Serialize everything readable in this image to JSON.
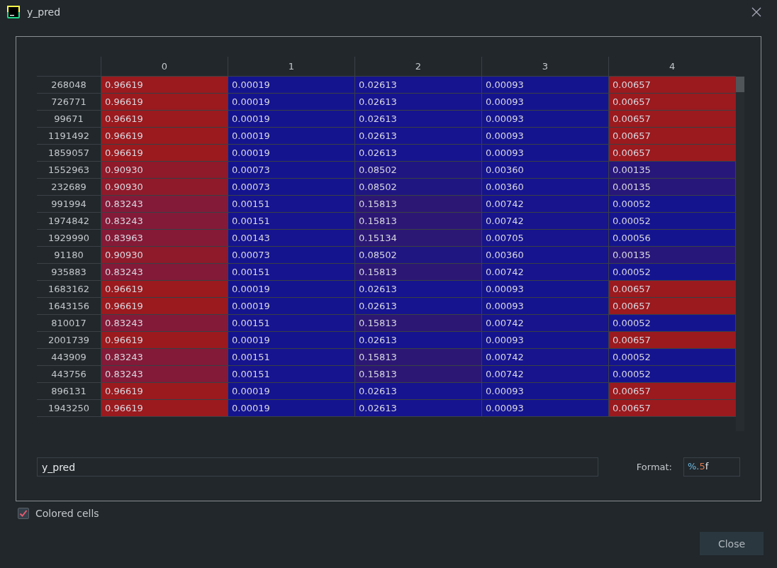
{
  "window": {
    "title": "y_pred"
  },
  "table": {
    "columns": [
      "0",
      "1",
      "2",
      "3",
      "4"
    ],
    "rows": [
      {
        "index": "268048",
        "cells": [
          {
            "value": "0.96619",
            "color": "#9a1a1e"
          },
          {
            "value": "0.00019",
            "color": "#15148f"
          },
          {
            "value": "0.02613",
            "color": "#16148e"
          },
          {
            "value": "0.00093",
            "color": "#15148f"
          },
          {
            "value": "0.00657",
            "color": "#9a1a1e"
          }
        ]
      },
      {
        "index": "726771",
        "cells": [
          {
            "value": "0.96619",
            "color": "#9a1a1e"
          },
          {
            "value": "0.00019",
            "color": "#15148f"
          },
          {
            "value": "0.02613",
            "color": "#16148e"
          },
          {
            "value": "0.00093",
            "color": "#15148f"
          },
          {
            "value": "0.00657",
            "color": "#9a1a1e"
          }
        ]
      },
      {
        "index": "99671",
        "cells": [
          {
            "value": "0.96619",
            "color": "#9a1a1e"
          },
          {
            "value": "0.00019",
            "color": "#15148f"
          },
          {
            "value": "0.02613",
            "color": "#16148e"
          },
          {
            "value": "0.00093",
            "color": "#15148f"
          },
          {
            "value": "0.00657",
            "color": "#9a1a1e"
          }
        ]
      },
      {
        "index": "1191492",
        "cells": [
          {
            "value": "0.96619",
            "color": "#9a1a1e"
          },
          {
            "value": "0.00019",
            "color": "#15148f"
          },
          {
            "value": "0.02613",
            "color": "#16148e"
          },
          {
            "value": "0.00093",
            "color": "#15148f"
          },
          {
            "value": "0.00657",
            "color": "#9a1a1e"
          }
        ]
      },
      {
        "index": "1859057",
        "cells": [
          {
            "value": "0.96619",
            "color": "#9a1a1e"
          },
          {
            "value": "0.00019",
            "color": "#15148f"
          },
          {
            "value": "0.02613",
            "color": "#16148e"
          },
          {
            "value": "0.00093",
            "color": "#15148f"
          },
          {
            "value": "0.00657",
            "color": "#9a1a1e"
          }
        ]
      },
      {
        "index": "1552963",
        "cells": [
          {
            "value": "0.90930",
            "color": "#8e1a2a"
          },
          {
            "value": "0.00073",
            "color": "#15148f"
          },
          {
            "value": "0.08502",
            "color": "#201682"
          },
          {
            "value": "0.00360",
            "color": "#16148e"
          },
          {
            "value": "0.00135",
            "color": "#28177a"
          }
        ]
      },
      {
        "index": "232689",
        "cells": [
          {
            "value": "0.90930",
            "color": "#8e1a2a"
          },
          {
            "value": "0.00073",
            "color": "#15148f"
          },
          {
            "value": "0.08502",
            "color": "#201682"
          },
          {
            "value": "0.00360",
            "color": "#16148e"
          },
          {
            "value": "0.00135",
            "color": "#28177a"
          }
        ]
      },
      {
        "index": "991994",
        "cells": [
          {
            "value": "0.83243",
            "color": "#821a38"
          },
          {
            "value": "0.00151",
            "color": "#16148e"
          },
          {
            "value": "0.15813",
            "color": "#2c1874"
          },
          {
            "value": "0.00742",
            "color": "#17148d"
          },
          {
            "value": "0.00052",
            "color": "#15148f"
          }
        ]
      },
      {
        "index": "1974842",
        "cells": [
          {
            "value": "0.83243",
            "color": "#821a38"
          },
          {
            "value": "0.00151",
            "color": "#16148e"
          },
          {
            "value": "0.15813",
            "color": "#2c1874"
          },
          {
            "value": "0.00742",
            "color": "#17148d"
          },
          {
            "value": "0.00052",
            "color": "#15148f"
          }
        ]
      },
      {
        "index": "1929990",
        "cells": [
          {
            "value": "0.83963",
            "color": "#841a36"
          },
          {
            "value": "0.00143",
            "color": "#16148e"
          },
          {
            "value": "0.15134",
            "color": "#2b1875"
          },
          {
            "value": "0.00705",
            "color": "#17148d"
          },
          {
            "value": "0.00056",
            "color": "#15148f"
          }
        ]
      },
      {
        "index": "91180",
        "cells": [
          {
            "value": "0.90930",
            "color": "#8e1a2a"
          },
          {
            "value": "0.00073",
            "color": "#15148f"
          },
          {
            "value": "0.08502",
            "color": "#201682"
          },
          {
            "value": "0.00360",
            "color": "#16148e"
          },
          {
            "value": "0.00135",
            "color": "#28177a"
          }
        ]
      },
      {
        "index": "935883",
        "cells": [
          {
            "value": "0.83243",
            "color": "#821a38"
          },
          {
            "value": "0.00151",
            "color": "#16148e"
          },
          {
            "value": "0.15813",
            "color": "#2c1874"
          },
          {
            "value": "0.00742",
            "color": "#17148d"
          },
          {
            "value": "0.00052",
            "color": "#15148f"
          }
        ]
      },
      {
        "index": "1683162",
        "cells": [
          {
            "value": "0.96619",
            "color": "#9a1a1e"
          },
          {
            "value": "0.00019",
            "color": "#15148f"
          },
          {
            "value": "0.02613",
            "color": "#16148e"
          },
          {
            "value": "0.00093",
            "color": "#15148f"
          },
          {
            "value": "0.00657",
            "color": "#9a1a1e"
          }
        ]
      },
      {
        "index": "1643156",
        "cells": [
          {
            "value": "0.96619",
            "color": "#9a1a1e"
          },
          {
            "value": "0.00019",
            "color": "#15148f"
          },
          {
            "value": "0.02613",
            "color": "#16148e"
          },
          {
            "value": "0.00093",
            "color": "#15148f"
          },
          {
            "value": "0.00657",
            "color": "#9a1a1e"
          }
        ]
      },
      {
        "index": "810017",
        "cells": [
          {
            "value": "0.83243",
            "color": "#821a38"
          },
          {
            "value": "0.00151",
            "color": "#16148e"
          },
          {
            "value": "0.15813",
            "color": "#2c1874"
          },
          {
            "value": "0.00742",
            "color": "#17148d"
          },
          {
            "value": "0.00052",
            "color": "#15148f"
          }
        ]
      },
      {
        "index": "2001739",
        "cells": [
          {
            "value": "0.96619",
            "color": "#9a1a1e"
          },
          {
            "value": "0.00019",
            "color": "#15148f"
          },
          {
            "value": "0.02613",
            "color": "#16148e"
          },
          {
            "value": "0.00093",
            "color": "#15148f"
          },
          {
            "value": "0.00657",
            "color": "#9a1a1e"
          }
        ]
      },
      {
        "index": "443909",
        "cells": [
          {
            "value": "0.83243",
            "color": "#821a38"
          },
          {
            "value": "0.00151",
            "color": "#16148e"
          },
          {
            "value": "0.15813",
            "color": "#2c1874"
          },
          {
            "value": "0.00742",
            "color": "#17148d"
          },
          {
            "value": "0.00052",
            "color": "#15148f"
          }
        ]
      },
      {
        "index": "443756",
        "cells": [
          {
            "value": "0.83243",
            "color": "#821a38"
          },
          {
            "value": "0.00151",
            "color": "#16148e"
          },
          {
            "value": "0.15813",
            "color": "#2c1874"
          },
          {
            "value": "0.00742",
            "color": "#17148d"
          },
          {
            "value": "0.00052",
            "color": "#15148f"
          }
        ]
      },
      {
        "index": "896131",
        "cells": [
          {
            "value": "0.96619",
            "color": "#9a1a1e"
          },
          {
            "value": "0.00019",
            "color": "#15148f"
          },
          {
            "value": "0.02613",
            "color": "#16148e"
          },
          {
            "value": "0.00093",
            "color": "#15148f"
          },
          {
            "value": "0.00657",
            "color": "#9a1a1e"
          }
        ]
      },
      {
        "index": "1943250",
        "cells": [
          {
            "value": "0.96619",
            "color": "#9a1a1e"
          },
          {
            "value": "0.00019",
            "color": "#15148f"
          },
          {
            "value": "0.02613",
            "color": "#16148e"
          },
          {
            "value": "0.00093",
            "color": "#15148f"
          },
          {
            "value": "0.00657",
            "color": "#9a1a1e"
          }
        ]
      }
    ]
  },
  "expression": {
    "value": "y_pred"
  },
  "format": {
    "label": "Format:",
    "value": "%.5f"
  },
  "colored_cells": {
    "label": "Colored cells",
    "checked": true
  },
  "buttons": [
    "Close"
  ]
}
